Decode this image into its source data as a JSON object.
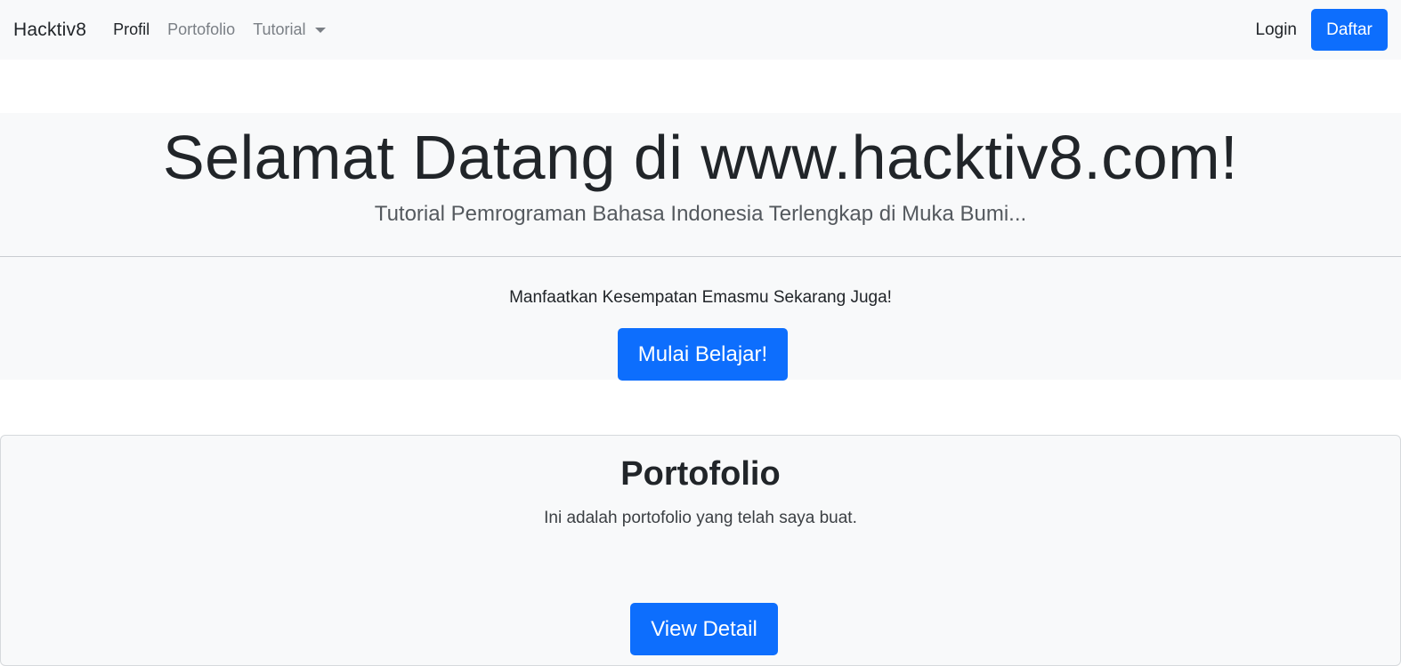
{
  "navbar": {
    "brand": "Hacktiv8",
    "links": [
      {
        "label": "Profil"
      },
      {
        "label": "Portofolio"
      },
      {
        "label": "Tutorial"
      }
    ],
    "login_label": "Login",
    "register_label": "Daftar"
  },
  "hero": {
    "title": "Selamat Datang di www.hacktiv8.com!",
    "subtitle": "Tutorial Pemrograman Bahasa Indonesia Terlengkap di Muka Bumi...",
    "lead": "Manfaatkan Kesempatan Emasmu Sekarang Juga!",
    "cta_label": "Mulai Belajar!"
  },
  "portfolio": {
    "title": "Portofolio",
    "text": "Ini adalah portofolio yang telah saya buat.",
    "button_label": "View Detail"
  },
  "colors": {
    "primary": "#0d6efd",
    "light_bg": "#f8f9fa",
    "text_dark": "#212529",
    "text_muted": "#7a7f85"
  }
}
